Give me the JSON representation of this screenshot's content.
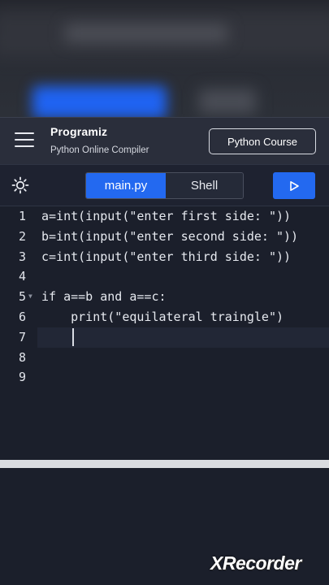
{
  "header": {
    "logo_text": "Programiz",
    "subtitle": "Python Online Compiler",
    "course_button": "Python Course"
  },
  "toolbar": {
    "tab_main": "main.py",
    "tab_shell": "Shell",
    "theme_icon": "sun-icon",
    "run_icon": "play-icon"
  },
  "editor": {
    "lines": [
      {
        "num": "1",
        "text": "a=int(input(\"enter first side: \"))"
      },
      {
        "num": "2",
        "text": "b=int(input(\"enter second side: \"))"
      },
      {
        "num": "3",
        "text": "c=int(input(\"enter third side: \"))"
      },
      {
        "num": "4",
        "text": ""
      },
      {
        "num": "5",
        "text": "if a==b and a==c:"
      },
      {
        "num": "6",
        "text": "    print(\"equilateral traingle\")"
      },
      {
        "num": "7",
        "text": ""
      },
      {
        "num": "8",
        "text": ""
      },
      {
        "num": "9",
        "text": ""
      }
    ]
  },
  "watermark": "XRecorder",
  "colors": {
    "accent": "#2369f0",
    "editor_bg": "#1b1f2b",
    "header_bg": "#2a2e3b"
  }
}
